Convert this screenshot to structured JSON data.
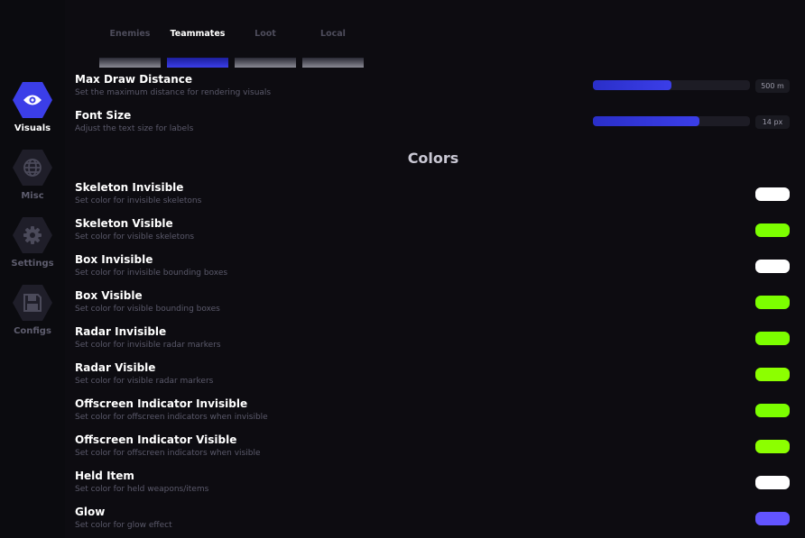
{
  "sidebar": {
    "items": [
      {
        "label": "Visuals",
        "icon": "eye-icon",
        "active": true
      },
      {
        "label": "Misc",
        "icon": "globe-icon",
        "active": false
      },
      {
        "label": "Settings",
        "icon": "gear-icon",
        "active": false
      },
      {
        "label": "Configs",
        "icon": "save-icon",
        "active": false
      }
    ]
  },
  "tabs": [
    {
      "label": "Enemies",
      "active": false
    },
    {
      "label": "Teammates",
      "active": true
    },
    {
      "label": "Loot",
      "active": false
    },
    {
      "label": "Local",
      "active": false
    }
  ],
  "sliders": [
    {
      "title": "Max Draw Distance",
      "description": "Set the maximum distance for rendering visuals",
      "value": "500 m",
      "fill_fraction": 0.5
    },
    {
      "title": "Font Size",
      "description": "Adjust the text size for labels",
      "value": "14 px",
      "fill_fraction": 0.68
    }
  ],
  "colors_heading": "Colors",
  "colors": [
    {
      "title": "Skeleton Invisible",
      "description": "Set color for invisible skeletons",
      "color": "#ffffff"
    },
    {
      "title": "Skeleton Visible",
      "description": "Set color for visible skeletons",
      "color": "#7cff00"
    },
    {
      "title": "Box Invisible",
      "description": "Set color for invisible bounding boxes",
      "color": "#ffffff"
    },
    {
      "title": "Box Visible",
      "description": "Set color for visible bounding boxes",
      "color": "#7cff00"
    },
    {
      "title": "Radar Invisible",
      "description": "Set color for invisible radar markers",
      "color": "#7cff00"
    },
    {
      "title": "Radar Visible",
      "description": "Set color for visible radar markers",
      "color": "#8cff00"
    },
    {
      "title": "Offscreen Indicator Invisible",
      "description": "Set color for offscreen indicators when invisible",
      "color": "#7cff00"
    },
    {
      "title": "Offscreen Indicator Visible",
      "description": "Set color for offscreen indicators when visible",
      "color": "#8cff00"
    },
    {
      "title": "Held Item",
      "description": "Set color for held weapons/items",
      "color": "#ffffff"
    },
    {
      "title": "Glow",
      "description": "Set color for glow effect",
      "color": "#6254ff"
    }
  ],
  "accent_color": "#3b3ee8"
}
